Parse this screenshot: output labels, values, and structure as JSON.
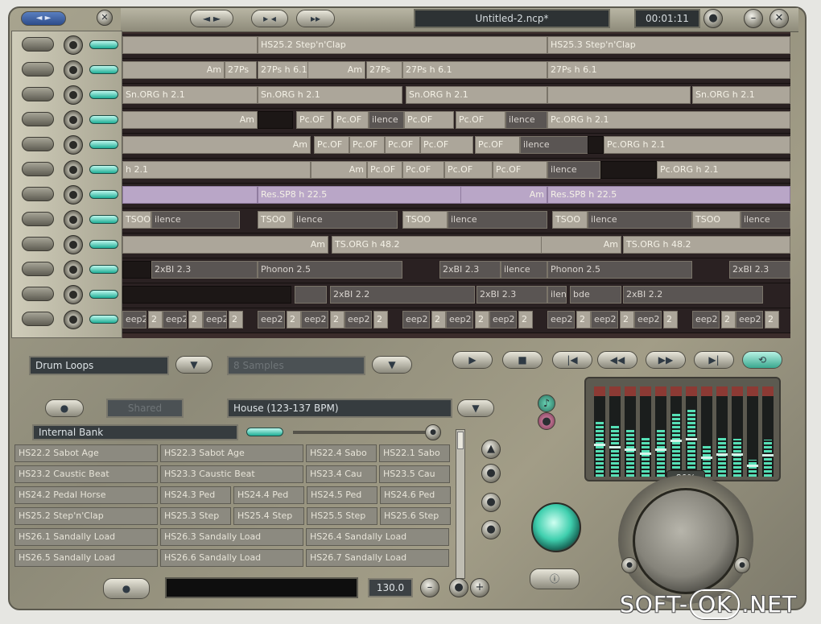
{
  "window": {
    "title": "Untitled-2.ncp*",
    "time": "00:01:11"
  },
  "topbar": {
    "btn1": "◄ ►",
    "btn2": "▸ ◂",
    "btn3": "▸▸"
  },
  "tracks": [
    {
      "segments": [
        {
          "text": "",
          "style": "light",
          "start": 0,
          "width": 168
        },
        {
          "text": "HS25.2 Step'n'Clap",
          "style": "light",
          "start": 168,
          "width": 360
        },
        {
          "text": "HS25.3 Step'n'Clap",
          "style": "light",
          "start": 528,
          "width": 302
        }
      ]
    },
    {
      "segments": [
        {
          "text": "Am",
          "style": "light",
          "start": 0,
          "width": 127,
          "align": "right"
        },
        {
          "text": "27Ps",
          "style": "light",
          "start": 127,
          "width": 40
        },
        {
          "text": "27Ps h 6.1",
          "style": "light",
          "start": 168,
          "width": 134
        },
        {
          "text": "Am",
          "style": "light",
          "start": 230,
          "width": 72,
          "align": "right"
        },
        {
          "text": "27Ps",
          "style": "light",
          "start": 303,
          "width": 45
        },
        {
          "text": "27Ps h 6.1",
          "style": "light",
          "start": 348,
          "width": 180
        },
        {
          "text": "27Ps h 6.1",
          "style": "light",
          "start": 528,
          "width": 302
        }
      ]
    },
    {
      "segments": [
        {
          "text": "Sn.ORG h 2.1",
          "style": "light",
          "start": 0,
          "width": 168
        },
        {
          "text": "Sn.ORG h 2.1",
          "style": "light",
          "start": 168,
          "width": 180
        },
        {
          "text": "Sn.ORG h 2.1",
          "style": "light",
          "start": 352,
          "width": 176
        },
        {
          "text": "",
          "style": "light",
          "start": 528,
          "width": 178
        },
        {
          "text": "Sn.ORG h 2.1",
          "style": "light",
          "start": 708,
          "width": 122
        }
      ]
    },
    {
      "segments": [
        {
          "text": "Am",
          "style": "light",
          "start": 0,
          "width": 168,
          "align": "right"
        },
        {
          "text": "",
          "style": "black",
          "start": 168,
          "width": 44
        },
        {
          "text": "Pc.OF",
          "style": "light",
          "start": 216,
          "width": 44
        },
        {
          "text": "Pc.OF",
          "style": "light",
          "start": 262,
          "width": 44
        },
        {
          "text": "ilence",
          "style": "dark",
          "start": 306,
          "width": 44
        },
        {
          "text": "Pc.OF",
          "style": "light",
          "start": 350,
          "width": 62
        },
        {
          "text": "Pc.OF",
          "style": "light",
          "start": 414,
          "width": 62
        },
        {
          "text": "ilence",
          "style": "dark",
          "start": 476,
          "width": 52
        },
        {
          "text": "Pc.ORG h 2.1",
          "style": "light",
          "start": 528,
          "width": 302
        }
      ]
    },
    {
      "segments": [
        {
          "text": "Am",
          "style": "light",
          "start": 0,
          "width": 234,
          "align": "right"
        },
        {
          "text": "Pc.OF",
          "style": "light",
          "start": 238,
          "width": 44
        },
        {
          "text": "Pc.OF",
          "style": "light",
          "start": 282,
          "width": 44
        },
        {
          "text": "Pc.OF",
          "style": "light",
          "start": 326,
          "width": 44
        },
        {
          "text": "Pc.OF",
          "style": "light",
          "start": 370,
          "width": 66
        },
        {
          "text": "Pc.OF",
          "style": "light",
          "start": 438,
          "width": 56
        },
        {
          "text": "ilence",
          "style": "dark",
          "start": 494,
          "width": 100
        },
        {
          "text": "",
          "style": "black",
          "start": 578,
          "width": 20
        },
        {
          "text": "Pc.ORG h 2.1",
          "style": "light",
          "start": 598,
          "width": 232
        }
      ]
    },
    {
      "segments": [
        {
          "text": "h 2.1",
          "style": "light",
          "start": 0,
          "width": 234
        },
        {
          "text": "Am",
          "style": "light",
          "start": 234,
          "width": 70,
          "align": "right"
        },
        {
          "text": "Pc.OF",
          "style": "light",
          "start": 304,
          "width": 44
        },
        {
          "text": "Pc.OF",
          "style": "light",
          "start": 348,
          "width": 52
        },
        {
          "text": "Pc.OF",
          "style": "light",
          "start": 400,
          "width": 60
        },
        {
          "text": "Pc.OF",
          "style": "light",
          "start": 460,
          "width": 68
        },
        {
          "text": "ilence",
          "style": "dark",
          "start": 528,
          "width": 66
        },
        {
          "text": "",
          "style": "black",
          "start": 594,
          "width": 70
        },
        {
          "text": "Pc.ORG h 2.1",
          "style": "light",
          "start": 664,
          "width": 166
        }
      ]
    },
    {
      "segments": [
        {
          "text": "",
          "style": "purple",
          "start": 0,
          "width": 168
        },
        {
          "text": "Res.SP8 h 22.5",
          "style": "purple",
          "start": 168,
          "width": 360
        },
        {
          "text": "Am",
          "style": "purple",
          "start": 420,
          "width": 108,
          "align": "right"
        },
        {
          "text": "Res.SP8 h 22.5",
          "style": "purple",
          "start": 528,
          "width": 302
        }
      ]
    },
    {
      "segments": [
        {
          "text": "TSOO",
          "style": "light",
          "start": 0,
          "width": 36
        },
        {
          "text": "ilence",
          "style": "dark",
          "start": 36,
          "width": 110
        },
        {
          "text": "TSOO",
          "style": "light",
          "start": 168,
          "width": 44
        },
        {
          "text": "ilence",
          "style": "dark",
          "start": 212,
          "width": 130
        },
        {
          "text": "TSOO",
          "style": "light",
          "start": 348,
          "width": 56
        },
        {
          "text": "ilence",
          "style": "dark",
          "start": 404,
          "width": 124
        },
        {
          "text": "TSOO",
          "style": "light",
          "start": 534,
          "width": 44
        },
        {
          "text": "ilence",
          "style": "dark",
          "start": 578,
          "width": 130
        },
        {
          "text": "TSOO",
          "style": "light",
          "start": 708,
          "width": 60
        },
        {
          "text": "ilence",
          "style": "dark",
          "start": 768,
          "width": 62
        }
      ]
    },
    {
      "segments": [
        {
          "text": "Am",
          "style": "light",
          "start": 0,
          "width": 256,
          "align": "right"
        },
        {
          "text": "TS.ORG h 48.2",
          "style": "light",
          "start": 260,
          "width": 360
        },
        {
          "text": "Am",
          "style": "light",
          "start": 520,
          "width": 100,
          "align": "right"
        },
        {
          "text": "TS.ORG h 48.2",
          "style": "light",
          "start": 622,
          "width": 208
        }
      ]
    },
    {
      "segments": [
        {
          "text": "",
          "style": "black",
          "start": 0,
          "width": 36
        },
        {
          "text": "2xBI 2.3",
          "style": "dark",
          "start": 36,
          "width": 132
        },
        {
          "text": "Phonon 2.5",
          "style": "dark",
          "start": 168,
          "width": 180
        },
        {
          "text": "2xBI 2.3",
          "style": "dark",
          "start": 394,
          "width": 76
        },
        {
          "text": "ilence",
          "style": "dark",
          "start": 470,
          "width": 58
        },
        {
          "text": "Phonon 2.5",
          "style": "dark",
          "start": 528,
          "width": 180
        },
        {
          "text": "2xBI 2.3",
          "style": "dark",
          "start": 754,
          "width": 76
        }
      ]
    },
    {
      "segments": [
        {
          "text": "",
          "style": "black",
          "start": 0,
          "width": 210
        },
        {
          "text": "",
          "style": "dark",
          "start": 214,
          "width": 40
        },
        {
          "text": "2xBI 2.2",
          "style": "dark",
          "start": 258,
          "width": 180
        },
        {
          "text": "2xBI 2.3",
          "style": "dark",
          "start": 440,
          "width": 88
        },
        {
          "text": "ilence",
          "style": "dark",
          "start": 528,
          "width": 24
        },
        {
          "text": "bde",
          "style": "dark",
          "start": 556,
          "width": 64
        },
        {
          "text": "2xBI 2.2",
          "style": "dark",
          "start": 622,
          "width": 174
        }
      ]
    },
    {
      "segments": [
        {
          "text": "eep2",
          "style": "dark",
          "start": 0,
          "width": 30
        },
        {
          "text": "2",
          "style": "light",
          "start": 32,
          "width": 18
        },
        {
          "text": "eep2",
          "style": "dark",
          "start": 50,
          "width": 30
        },
        {
          "text": "2",
          "style": "light",
          "start": 82,
          "width": 18
        },
        {
          "text": "eep2",
          "style": "dark",
          "start": 100,
          "width": 30
        },
        {
          "text": "2",
          "style": "light",
          "start": 132,
          "width": 18
        },
        {
          "text": "eep2",
          "style": "dark",
          "start": 168,
          "width": 34
        },
        {
          "text": "2",
          "style": "light",
          "start": 204,
          "width": 18
        },
        {
          "text": "eep2",
          "style": "dark",
          "start": 222,
          "width": 34
        },
        {
          "text": "2",
          "style": "light",
          "start": 258,
          "width": 18
        },
        {
          "text": "eep2",
          "style": "dark",
          "start": 276,
          "width": 34
        },
        {
          "text": "2",
          "style": "light",
          "start": 312,
          "width": 18
        },
        {
          "text": "eep2",
          "style": "dark",
          "start": 348,
          "width": 34
        },
        {
          "text": "2",
          "style": "light",
          "start": 384,
          "width": 18
        },
        {
          "text": "eep2",
          "style": "dark",
          "start": 402,
          "width": 34
        },
        {
          "text": "2",
          "style": "light",
          "start": 438,
          "width": 18
        },
        {
          "text": "eep2",
          "style": "dark",
          "start": 456,
          "width": 34
        },
        {
          "text": "2",
          "style": "light",
          "start": 492,
          "width": 18
        },
        {
          "text": "eep2",
          "style": "dark",
          "start": 528,
          "width": 34
        },
        {
          "text": "2",
          "style": "light",
          "start": 564,
          "width": 18
        },
        {
          "text": "eep2",
          "style": "dark",
          "start": 582,
          "width": 34
        },
        {
          "text": "2",
          "style": "light",
          "start": 618,
          "width": 18
        },
        {
          "text": "eep2",
          "style": "dark",
          "start": 636,
          "width": 34
        },
        {
          "text": "2",
          "style": "light",
          "start": 672,
          "width": 18
        },
        {
          "text": "eep2",
          "style": "dark",
          "start": 708,
          "width": 34
        },
        {
          "text": "2",
          "style": "light",
          "start": 744,
          "width": 18
        },
        {
          "text": "eep2",
          "style": "dark",
          "start": 762,
          "width": 34
        },
        {
          "text": "2",
          "style": "light",
          "start": 798,
          "width": 18
        }
      ]
    }
  ],
  "browser": {
    "category": "Drum Loops",
    "disabled_dropdown": "8 Samples",
    "filter_button": "Shared",
    "genre": "House (123-137 BPM)",
    "bank": "Internal Bank",
    "samples": [
      [
        "HS22.2 Sabot Age",
        "HS22.3 Sabot Age",
        "HS22.4 Sabo",
        "HS22.1 Sabo"
      ],
      [
        "HS23.2 Caustic Beat",
        "HS23.3 Caustic Beat",
        "HS23.4 Cau",
        "HS23.5 Cau"
      ],
      [
        "HS24.2 Pedal Horse",
        "HS24.3 Ped",
        "HS24.4 Ped",
        "HS24.5 Ped",
        "HS24.6 Ped"
      ],
      [
        "HS25.2 Step'n'Clap",
        "HS25.3 Step",
        "HS25.4 Step",
        "HS25.5 Step",
        "HS25.6 Step"
      ],
      [
        "HS26.1 Sandally Load",
        "HS26.3 Sandally Load",
        "HS26.4 Sandally Load"
      ],
      [
        "HS26.5 Sandally Load",
        "HS26.6 Sandally Load",
        "HS26.7 Sandally Load"
      ]
    ]
  },
  "bpm": "130.0",
  "mixer": {
    "volume_percent": "80%",
    "levels": [
      0.72,
      0.66,
      0.61,
      0.52,
      0.6,
      0.82,
      0.86,
      0.41,
      0.5,
      0.49,
      0.22,
      0.48
    ],
    "meter_color": "#56e0b6",
    "cap_color": "#8c3a34"
  },
  "watermark": {
    "left": "SOFT-",
    "ok": "OK",
    "right": ".NET"
  }
}
